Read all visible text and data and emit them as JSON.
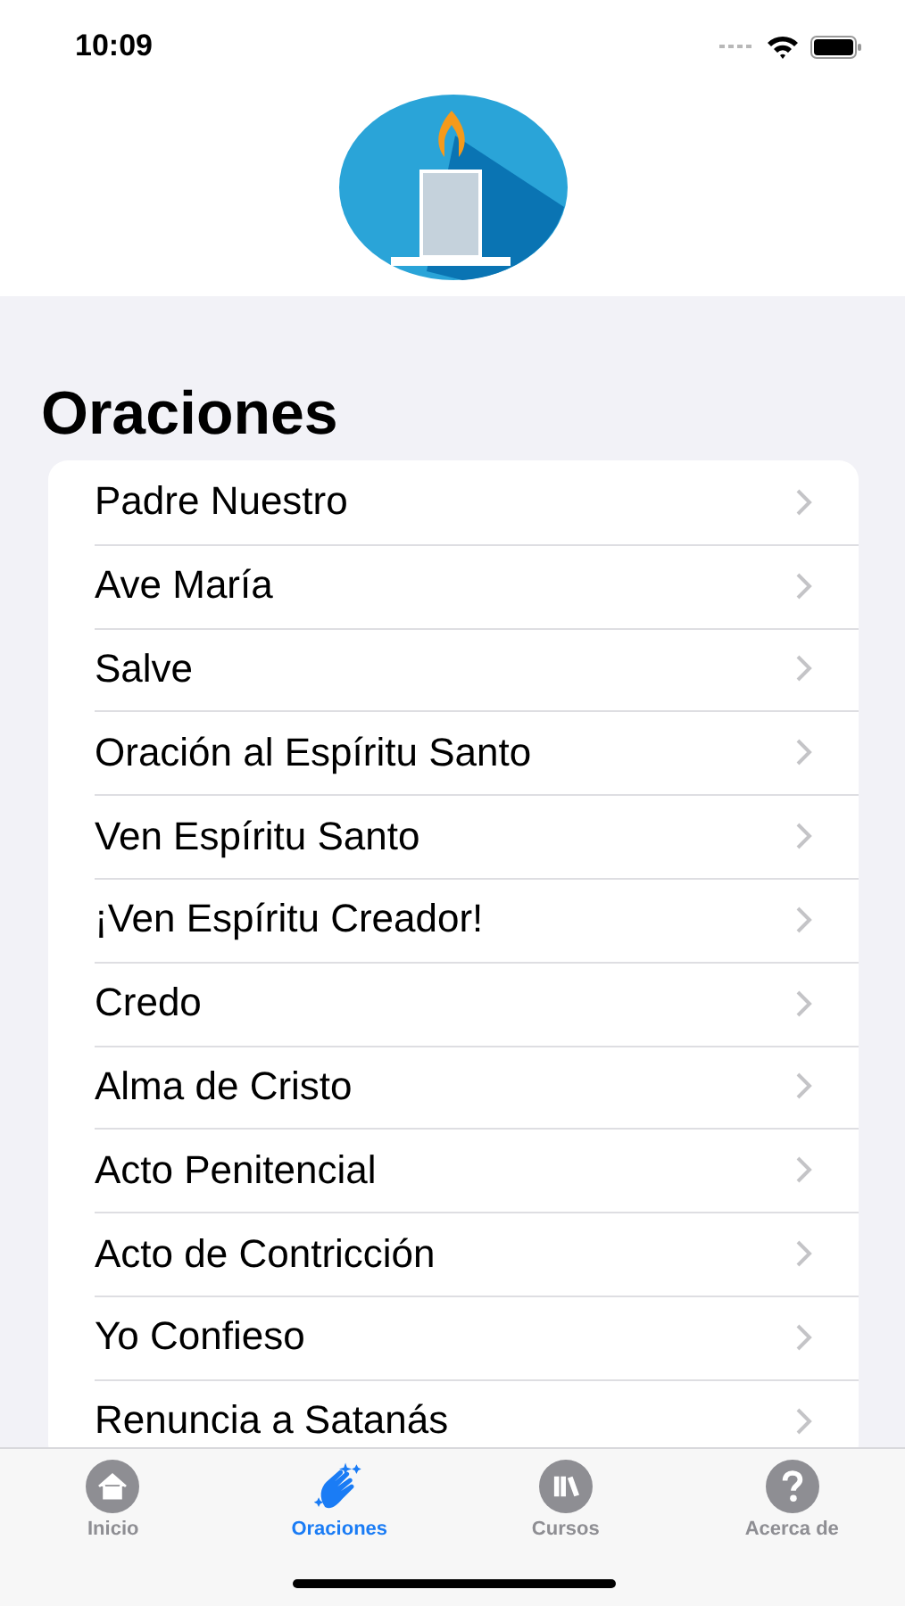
{
  "status_bar": {
    "time": "10:09"
  },
  "title": "Oraciones",
  "prayers": [
    {
      "label": "Padre Nuestro"
    },
    {
      "label": "Ave María"
    },
    {
      "label": "Salve"
    },
    {
      "label": "Oración al Espíritu Santo"
    },
    {
      "label": "Ven Espíritu Santo"
    },
    {
      "label": "¡Ven Espíritu Creador!"
    },
    {
      "label": "Credo"
    },
    {
      "label": "Alma de Cristo"
    },
    {
      "label": "Acto Penitencial"
    },
    {
      "label": "Acto de Contricción"
    },
    {
      "label": "Yo Confieso"
    },
    {
      "label": "Renuncia a Satanás"
    }
  ],
  "tab_bar": [
    {
      "label": "Inicio",
      "kind": "home",
      "selected": false
    },
    {
      "label": "Oraciones",
      "kind": "hands",
      "selected": true
    },
    {
      "label": "Cursos",
      "kind": "books",
      "selected": false
    },
    {
      "label": "Acerca de",
      "kind": "help",
      "selected": false
    }
  ]
}
